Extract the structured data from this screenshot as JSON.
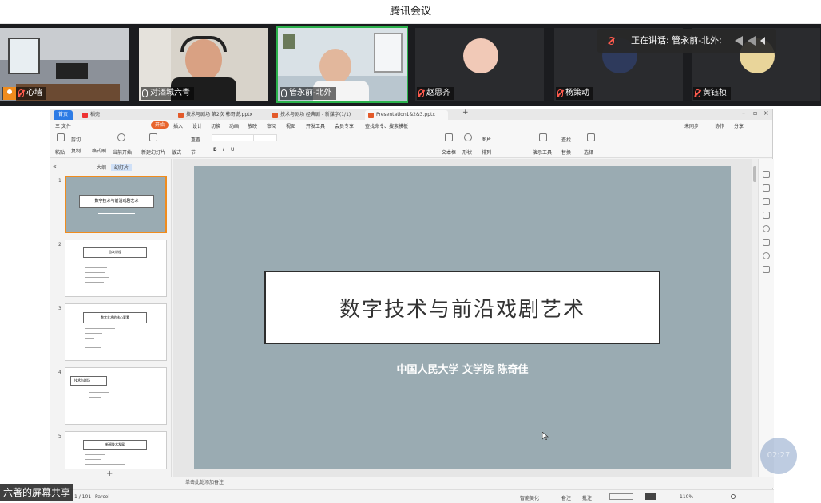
{
  "app_title": "腾讯会议",
  "participants": [
    {
      "name": "心墙",
      "host": true,
      "muted": true
    },
    {
      "name": "对酒城六青",
      "muted": false
    },
    {
      "name": "管永前-北外",
      "muted": false,
      "speaking": true
    },
    {
      "name": "赵思齐",
      "muted": true
    },
    {
      "name": "杨策动",
      "muted": true
    },
    {
      "name": "黄钰桢",
      "muted": true
    }
  ],
  "speaking_now": "正在讲话: 管永前-北外;",
  "wps": {
    "tabs": [
      "首页",
      "稻壳",
      "技术与剧场 第2次 韩哥说.pptx",
      "技术与剧场 经典剧 - 新媒字(1/1)",
      "Presentation1&2&3.pptx"
    ],
    "menu": [
      "三 文件",
      "开始",
      "插入",
      "设计",
      "切换",
      "动画",
      "放映",
      "审阅",
      "视图",
      "开发工具",
      "会员专享",
      "查找命令、搜索模板"
    ],
    "menu_right": [
      "未同步",
      "协作",
      "分享"
    ],
    "ribbon": [
      "粘贴",
      "剪切",
      "复制",
      "格式刷",
      "当前开始",
      "新建幻灯片",
      "版式",
      "节",
      "重置",
      "文本框",
      "形状",
      "图片",
      "排列",
      "演示工具",
      "查找",
      "替换",
      "选择"
    ],
    "pane_tabs": [
      "大纲",
      "幻灯片"
    ],
    "thumbs": [
      {
        "num": "1",
        "title": "数字技术与前沿戏剧艺术"
      },
      {
        "num": "2",
        "title": "首次课程"
      },
      {
        "num": "3",
        "title": "数字艺术的核心要素"
      },
      {
        "num": "4",
        "title": "技术与剧场"
      },
      {
        "num": "5",
        "title": "新闻技术发展"
      }
    ],
    "slide_title": "数字技术与前沿戏剧艺术",
    "slide_subtitle": "中国人民大学 文学院 陈奇佳",
    "notes_placeholder": "单击此处添加备注",
    "status": {
      "slide_counter": "1 / 101",
      "theme": "Parcel",
      "beautify": "智能美化",
      "notes_btn": "备注",
      "comment_btn": "批注",
      "zoom": "110%"
    }
  },
  "share_label": "六著的屏幕共享",
  "timer": "02:27"
}
